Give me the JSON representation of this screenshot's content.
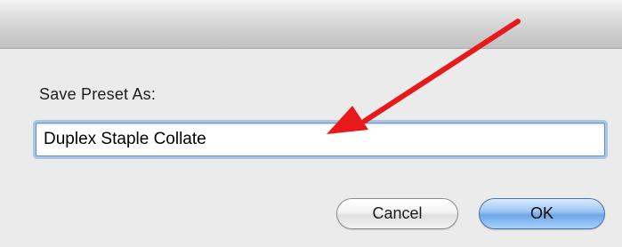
{
  "dialog": {
    "prompt_label": "Save Preset As:",
    "preset_name_value": "Duplex Staple Collate",
    "cancel_label": "Cancel",
    "ok_label": "OK"
  },
  "colors": {
    "annotation_arrow": "#e8191a",
    "default_button": "#6ea6e8",
    "focus_ring": "#a9c5ea"
  },
  "icons": {
    "annotation": "red-arrow-icon"
  }
}
